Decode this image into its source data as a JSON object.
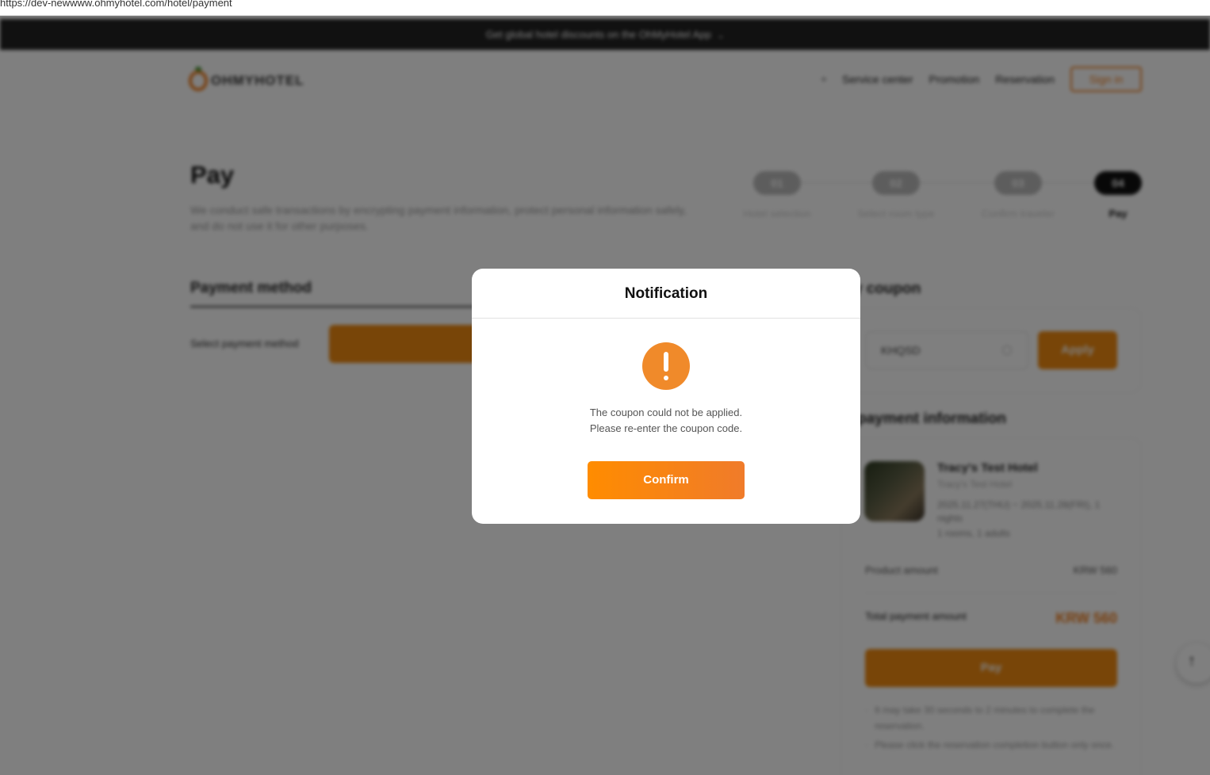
{
  "browser": {
    "url": "https://dev-newwww.ohmyhotel.com/hotel/payment"
  },
  "promo_bar": {
    "text": "Get global hotel discounts on the OhMyHotel App",
    "chevron_icon": "chevron-down-icon"
  },
  "header": {
    "logo_text": "OHMYHOTEL",
    "nav": [
      "Service center",
      "Promotion",
      "Reservation"
    ],
    "signin_label": "Sign in"
  },
  "pay": {
    "title": "Pay",
    "description": "We conduct safe transactions by encrypting payment information, protect personal information safely, and do not use it for other purposes."
  },
  "steps": [
    {
      "num": "01",
      "label": "Hotel selection"
    },
    {
      "num": "02",
      "label": "Select room type"
    },
    {
      "num": "03",
      "label": "Confirm traveler"
    },
    {
      "num": "04",
      "label": "Pay"
    }
  ],
  "payment_method": {
    "title": "Payment method",
    "select_label": "Select payment method"
  },
  "coupon": {
    "title": "ply coupon",
    "input_value": "KHQSD",
    "apply_label": "Apply"
  },
  "final_payment": {
    "title": "al payment information",
    "hotel_name": "Tracy's Test Hotel",
    "hotel_sub": "Tracy's Test Hotel",
    "dates": "2025.11.27(THU) ~ 2025.11.28(FRI), 1 nights",
    "guests": "1 rooms, 1 adults",
    "product_amount_label": "Product amount",
    "product_amount": "KRW 560",
    "total_label": "Total payment amount",
    "total_amount": "KRW 560",
    "pay_label": "Pay",
    "notes": [
      "It may take 30 seconds to 2 minutes to complete the reservation.",
      "Please click the reservation completion button only once."
    ]
  },
  "scroll_top_icon": "arrow-up-icon",
  "modal": {
    "title": "Notification",
    "icon": "exclamation-icon",
    "message_line1": "The coupon could not be applied.",
    "message_line2": "Please re-enter the coupon code.",
    "confirm_label": "Confirm"
  },
  "colors": {
    "brand_orange": "#f08a10",
    "dark_bar": "#222222"
  }
}
